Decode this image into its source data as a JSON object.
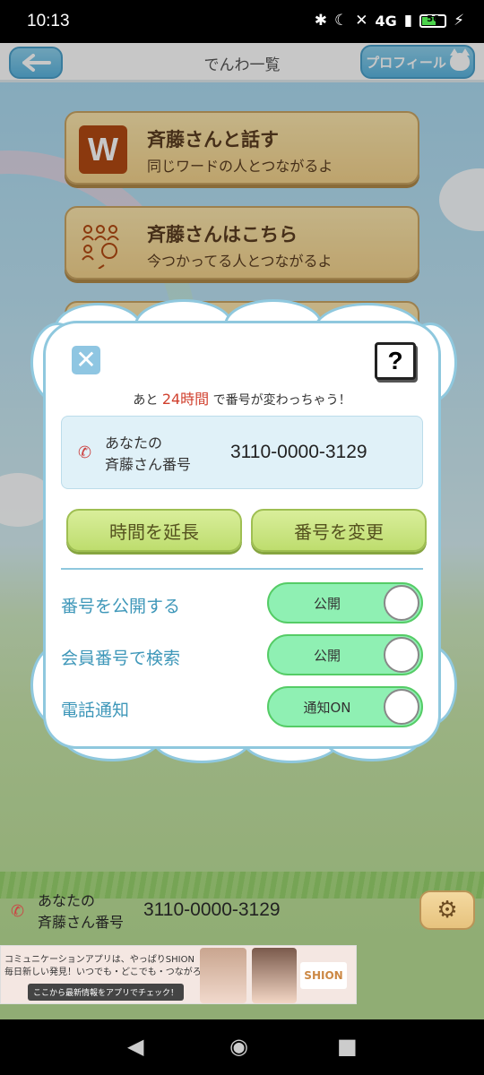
{
  "status_bar": {
    "time": "10:13",
    "network": "4G",
    "battery": "56"
  },
  "header": {
    "title": "でんわ一覧",
    "profile_label": "プロフィール"
  },
  "menu": [
    {
      "icon": "W",
      "title": "斉藤さんと話す",
      "subtitle": "同じワードの人とつながるよ"
    },
    {
      "title": "斉藤さんはこちら",
      "subtitle": "今つかってる人とつながるよ"
    }
  ],
  "modal": {
    "remain_prefix": "あと",
    "remain_hours": "24時間",
    "remain_suffix": "で番号が変わっちゃう！",
    "number_label_1": "あなたの",
    "number_label_2": "斉藤さん番号",
    "number": "3110-0000-3129",
    "extend_button": "時間を延長",
    "change_button": "番号を変更",
    "settings": [
      {
        "label": "番号を公開する",
        "toggle": "公開"
      },
      {
        "label": "会員番号で検索",
        "toggle": "公開"
      },
      {
        "label": "電話通知",
        "toggle": "通知ON"
      }
    ]
  },
  "bottom": {
    "label_1": "あなたの",
    "label_2": "斉藤さん番号",
    "number": "3110-0000-3129"
  },
  "ad": {
    "line1": "コミュニケーションアプリは、やっぱりSHION",
    "line2": "毎日新しい発見！いつでも・どこでも・つながろう！",
    "cta": "ここから最新情報をアプリでチェック！",
    "logo": "SHION"
  },
  "colors": {
    "accent_blue": "#5bb4de",
    "highlight_red": "#d0402e",
    "toggle_green": "#8ff0b3",
    "button_green": "#bedd6e"
  }
}
